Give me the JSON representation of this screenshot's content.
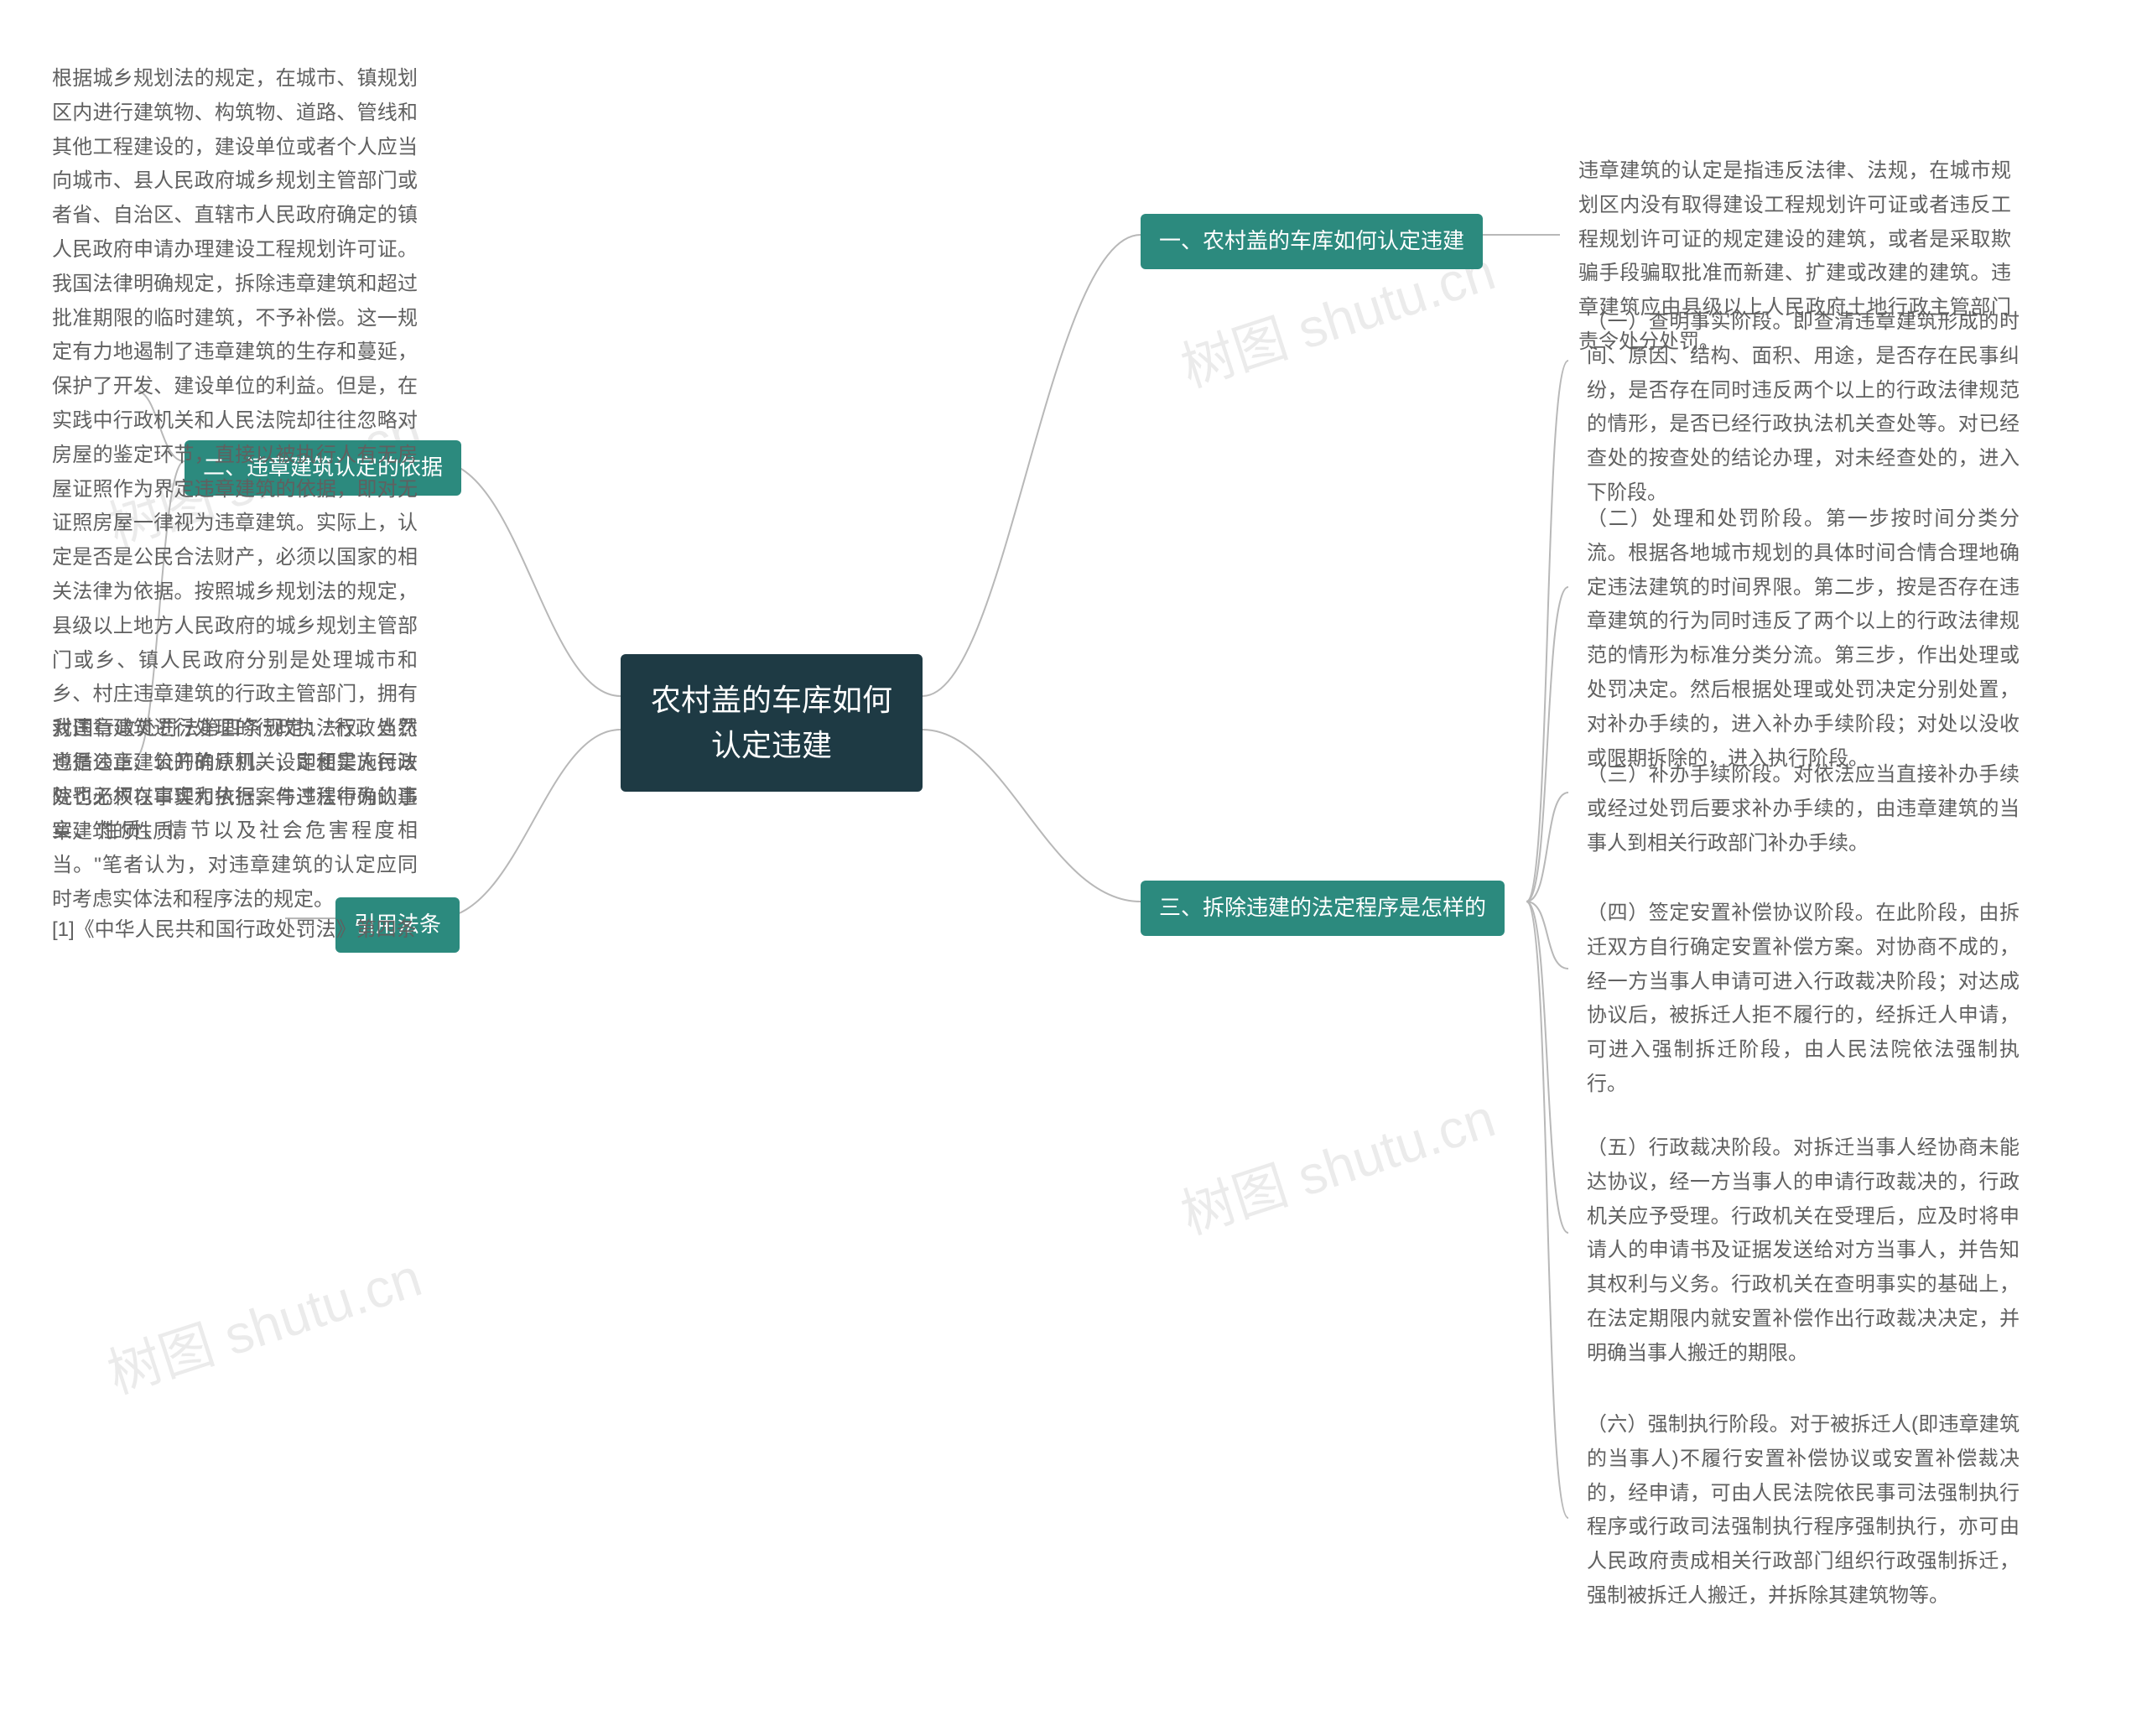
{
  "watermark": "树图 shutu.cn",
  "root": "农村盖的车库如何认定违建",
  "branches": {
    "b1": {
      "label": "一、农村盖的车库如何认定违建"
    },
    "b2": {
      "label": "二、违章建筑认定的依据"
    },
    "b3": {
      "label": "三、拆除违建的法定程序是怎样的"
    },
    "b4": {
      "label": "引用法条"
    }
  },
  "leaves": {
    "l1": "违章建筑的认定是指违反法律、法规，在城市规划区内没有取得建设工程规划许可证或者违反工程规划许可证的规定建设的建筑，或者是采取欺骗手段骗取批准而新建、扩建或改建的建筑。违章建筑应由县级以上人民政府土地行政主管部门责令处分处罚。",
    "l2a": "根据城乡规划法的规定，在城市、镇规划区内进行建筑物、构筑物、道路、管线和其他工程建设的，建设单位或者个人应当向城市、县人民政府城乡规划主管部门或者省、自治区、直辖市人民政府确定的镇人民政府申请办理建设工程规划许可证。我国法律明确规定，拆除违章建筑和超过批准期限的临时建筑，不予补偿。这一规定有力地遏制了违章建筑的生存和蔓延，保护了开发、建设单位的利益。但是，在实践中行政机关和人民法院却往往忽略对房屋的鉴定环节，直接以被执行人有无房屋证照作为界定违章建筑的依据，即对无证照房屋一律视为违章建筑。实际上，认定是否是公民合法财产，必须以国家的相关法律为依据。按照城乡规划法的规定，县级以上地方人民政府的城乡规划主管部门或乡、镇人民政府分别是处理城市和乡、村庄违章建筑的行政主管部门，拥有对违章建筑进行处理的行政执法权，当然也是违章建筑的确认机关，即便是人民法院也无权在审理和执行案件过程中确认违章建筑的性质。",
    "l2b": "我国行政处罚法第四条规定：\"行政处罚遵循公正、公开的原则。设定和实施行政处罚必须以事实为依据，与违法行为的事实、性质、情节以及社会危害程度相当。\"笔者认为，对违章建筑的认定应同时考虑实体法和程序法的规定。",
    "l3_1": "（一）查明事实阶段。即查清违章建筑形成的时间、原因、结构、面积、用途，是否存在民事纠纷，是否存在同时违反两个以上的行政法律规范的情形，是否已经行政执法机关查处等。对已经查处的按查处的结论办理，对未经查处的，进入下阶段。",
    "l3_2": "（二）处理和处罚阶段。第一步按时间分类分流。根据各地城市规划的具体时间合情合理地确定违法建筑的时间界限。第二步，按是否存在违章建筑的行为同时违反了两个以上的行政法律规范的情形为标准分类分流。第三步，作出处理或处罚决定。然后根据处理或处罚决定分别处置，对补办手续的，进入补办手续阶段；对处以没收或限期拆除的，进入执行阶段。",
    "l3_3": "（三）补办手续阶段。对依法应当直接补办手续或经过处罚后要求补办手续的，由违章建筑的当事人到相关行政部门补办手续。",
    "l3_4": "（四）签定安置补偿协议阶段。在此阶段，由拆迁双方自行确定安置补偿方案。对协商不成的，经一方当事人申请可进入行政裁决阶段；对达成协议后，被拆迁人拒不履行的，经拆迁人申请，可进入强制拆迁阶段，由人民法院依法强制执行。",
    "l3_5": "（五）行政裁决阶段。对拆迁当事人经协商未能达协议，经一方当事人的申请行政裁决的，行政机关应予受理。行政机关在受理后，应及时将申请人的申请书及证据发送给对方当事人，并告知其权利与义务。行政机关在查明事实的基础上，在法定期限内就安置补偿作出行政裁决决定，并明确当事人搬迁的期限。",
    "l3_6": "（六）强制执行阶段。对于被拆迁人(即违章建筑的当事人)不履行安置补偿协议或安置补偿裁决的，经申请，可由人民法院依民事司法强制执行程序或行政司法强制执行程序强制执行，亦可由人民政府责成相关行政部门组织行政强制拆迁，强制被拆迁人搬迁，并拆除其建筑物等。",
    "l4": "[1]《中华人民共和国行政处罚法》第四条"
  },
  "chart_data": {
    "type": "mindmap",
    "root": "农村盖的车库如何认定违建",
    "children": [
      {
        "label": "一、农村盖的车库如何认定违建",
        "side": "right",
        "children": [
          {
            "text_ref": "l1"
          }
        ]
      },
      {
        "label": "三、拆除违建的法定程序是怎样的",
        "side": "right",
        "children": [
          {
            "text_ref": "l3_1"
          },
          {
            "text_ref": "l3_2"
          },
          {
            "text_ref": "l3_3"
          },
          {
            "text_ref": "l3_4"
          },
          {
            "text_ref": "l3_5"
          },
          {
            "text_ref": "l3_6"
          }
        ]
      },
      {
        "label": "二、违章建筑认定的依据",
        "side": "left",
        "children": [
          {
            "text_ref": "l2a"
          },
          {
            "text_ref": "l2b"
          }
        ]
      },
      {
        "label": "引用法条",
        "side": "left",
        "children": [
          {
            "text_ref": "l4"
          }
        ]
      }
    ]
  }
}
